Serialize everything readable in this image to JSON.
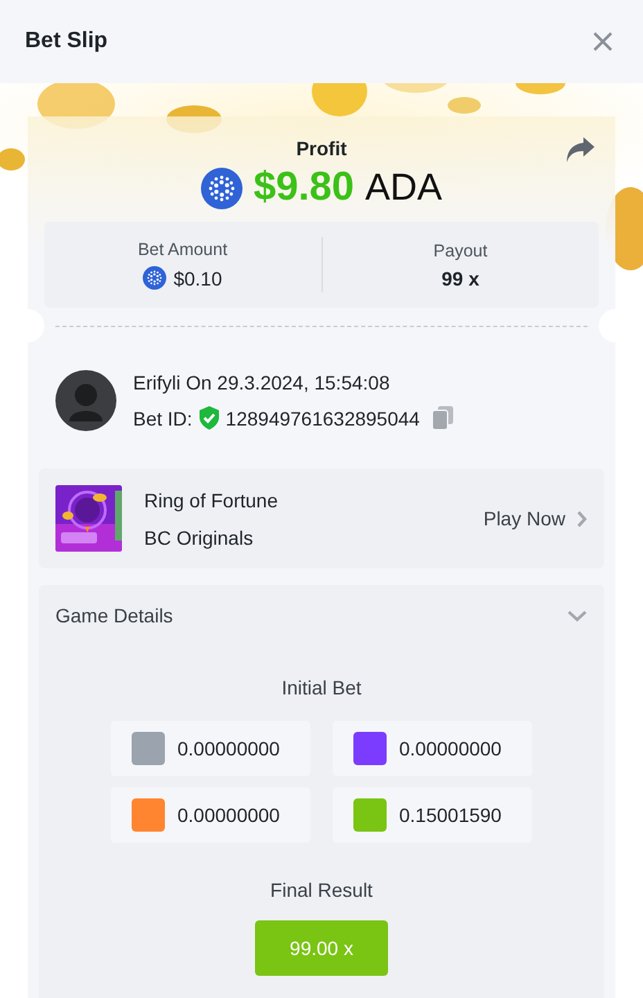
{
  "header": {
    "title": "Bet Slip"
  },
  "profit": {
    "label": "Profit",
    "amount": "$9.80",
    "currency": "ADA"
  },
  "stats": [
    {
      "label": "Bet Amount",
      "value": "$0.10",
      "kind": "coin"
    },
    {
      "label": "Payout",
      "value": "99 x",
      "kind": "plain"
    }
  ],
  "user": {
    "line": "Erifyli On 29.3.2024, 15:54:08",
    "bet_id_label": "Bet ID:",
    "bet_id": "128949761632895044",
    "verified": true
  },
  "game": {
    "title": "Ring of Fortune",
    "provider": "BC Originals",
    "action": "Play Now"
  },
  "details": {
    "title": "Game Details",
    "expanded": true,
    "initial_bet_label": "Initial Bet",
    "bets": [
      {
        "color": "#9aa3ae",
        "value": "0.00000000"
      },
      {
        "color": "#7b3cff",
        "value": "0.00000000"
      },
      {
        "color": "#ff8530",
        "value": "0.00000000"
      },
      {
        "color": "#7ac414",
        "value": "0.15001590"
      }
    ],
    "final_result_label": "Final Result",
    "final_result": "99.00 x"
  }
}
